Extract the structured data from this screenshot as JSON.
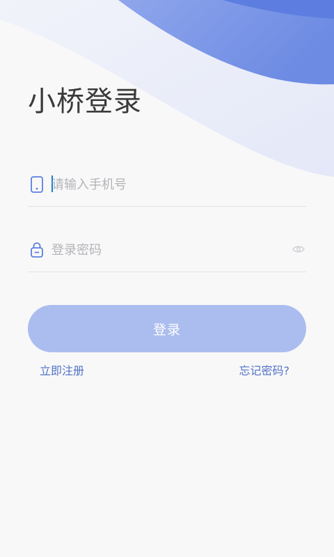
{
  "app": {
    "title": "小桥登录"
  },
  "phone_field": {
    "icon": "phone-icon",
    "placeholder": "请输入手机号",
    "value": ""
  },
  "password_field": {
    "icon": "lock-icon",
    "placeholder": "登录密码",
    "value": "",
    "visibility_toggle_icon": "eye-icon"
  },
  "login_button": {
    "label": "登录"
  },
  "links": {
    "register": "立即注册",
    "forgot_password": "忘记密码?"
  },
  "colors": {
    "accent": "#5a7fe0",
    "button_bg": "#abbdee",
    "link": "#5173c6",
    "title": "#3a3a3a",
    "background": "#f8f8f9"
  }
}
